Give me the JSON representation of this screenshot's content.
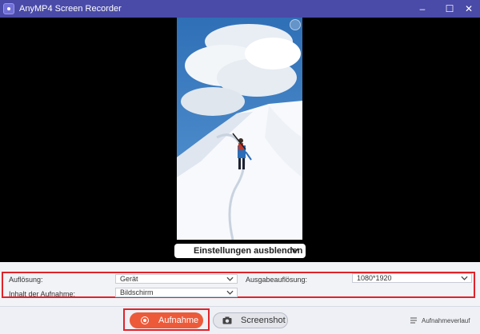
{
  "window": {
    "title": "AnyMP4 Screen Recorder",
    "controls": {
      "minimize": "–",
      "maximize": "☐",
      "close": "✕"
    }
  },
  "preview": {
    "toggle_label": "Einstellungen ausblenden"
  },
  "settings": {
    "resolution_label": "Auflösung:",
    "resolution_value": "Gerät",
    "output_resolution_label": "Ausgabeauflösung:",
    "output_resolution_value": "1080*1920",
    "content_label": "Inhalt der Aufnahme:",
    "content_value": "Bildschirm"
  },
  "actions": {
    "record_label": "Aufnahme",
    "screenshot_label": "Screenshot",
    "history_label": "Aufnahmeverlauf"
  },
  "colors": {
    "titlebar": "#4a4aa8",
    "record_button": "#ec5a3a",
    "highlight": "#e0232a"
  }
}
